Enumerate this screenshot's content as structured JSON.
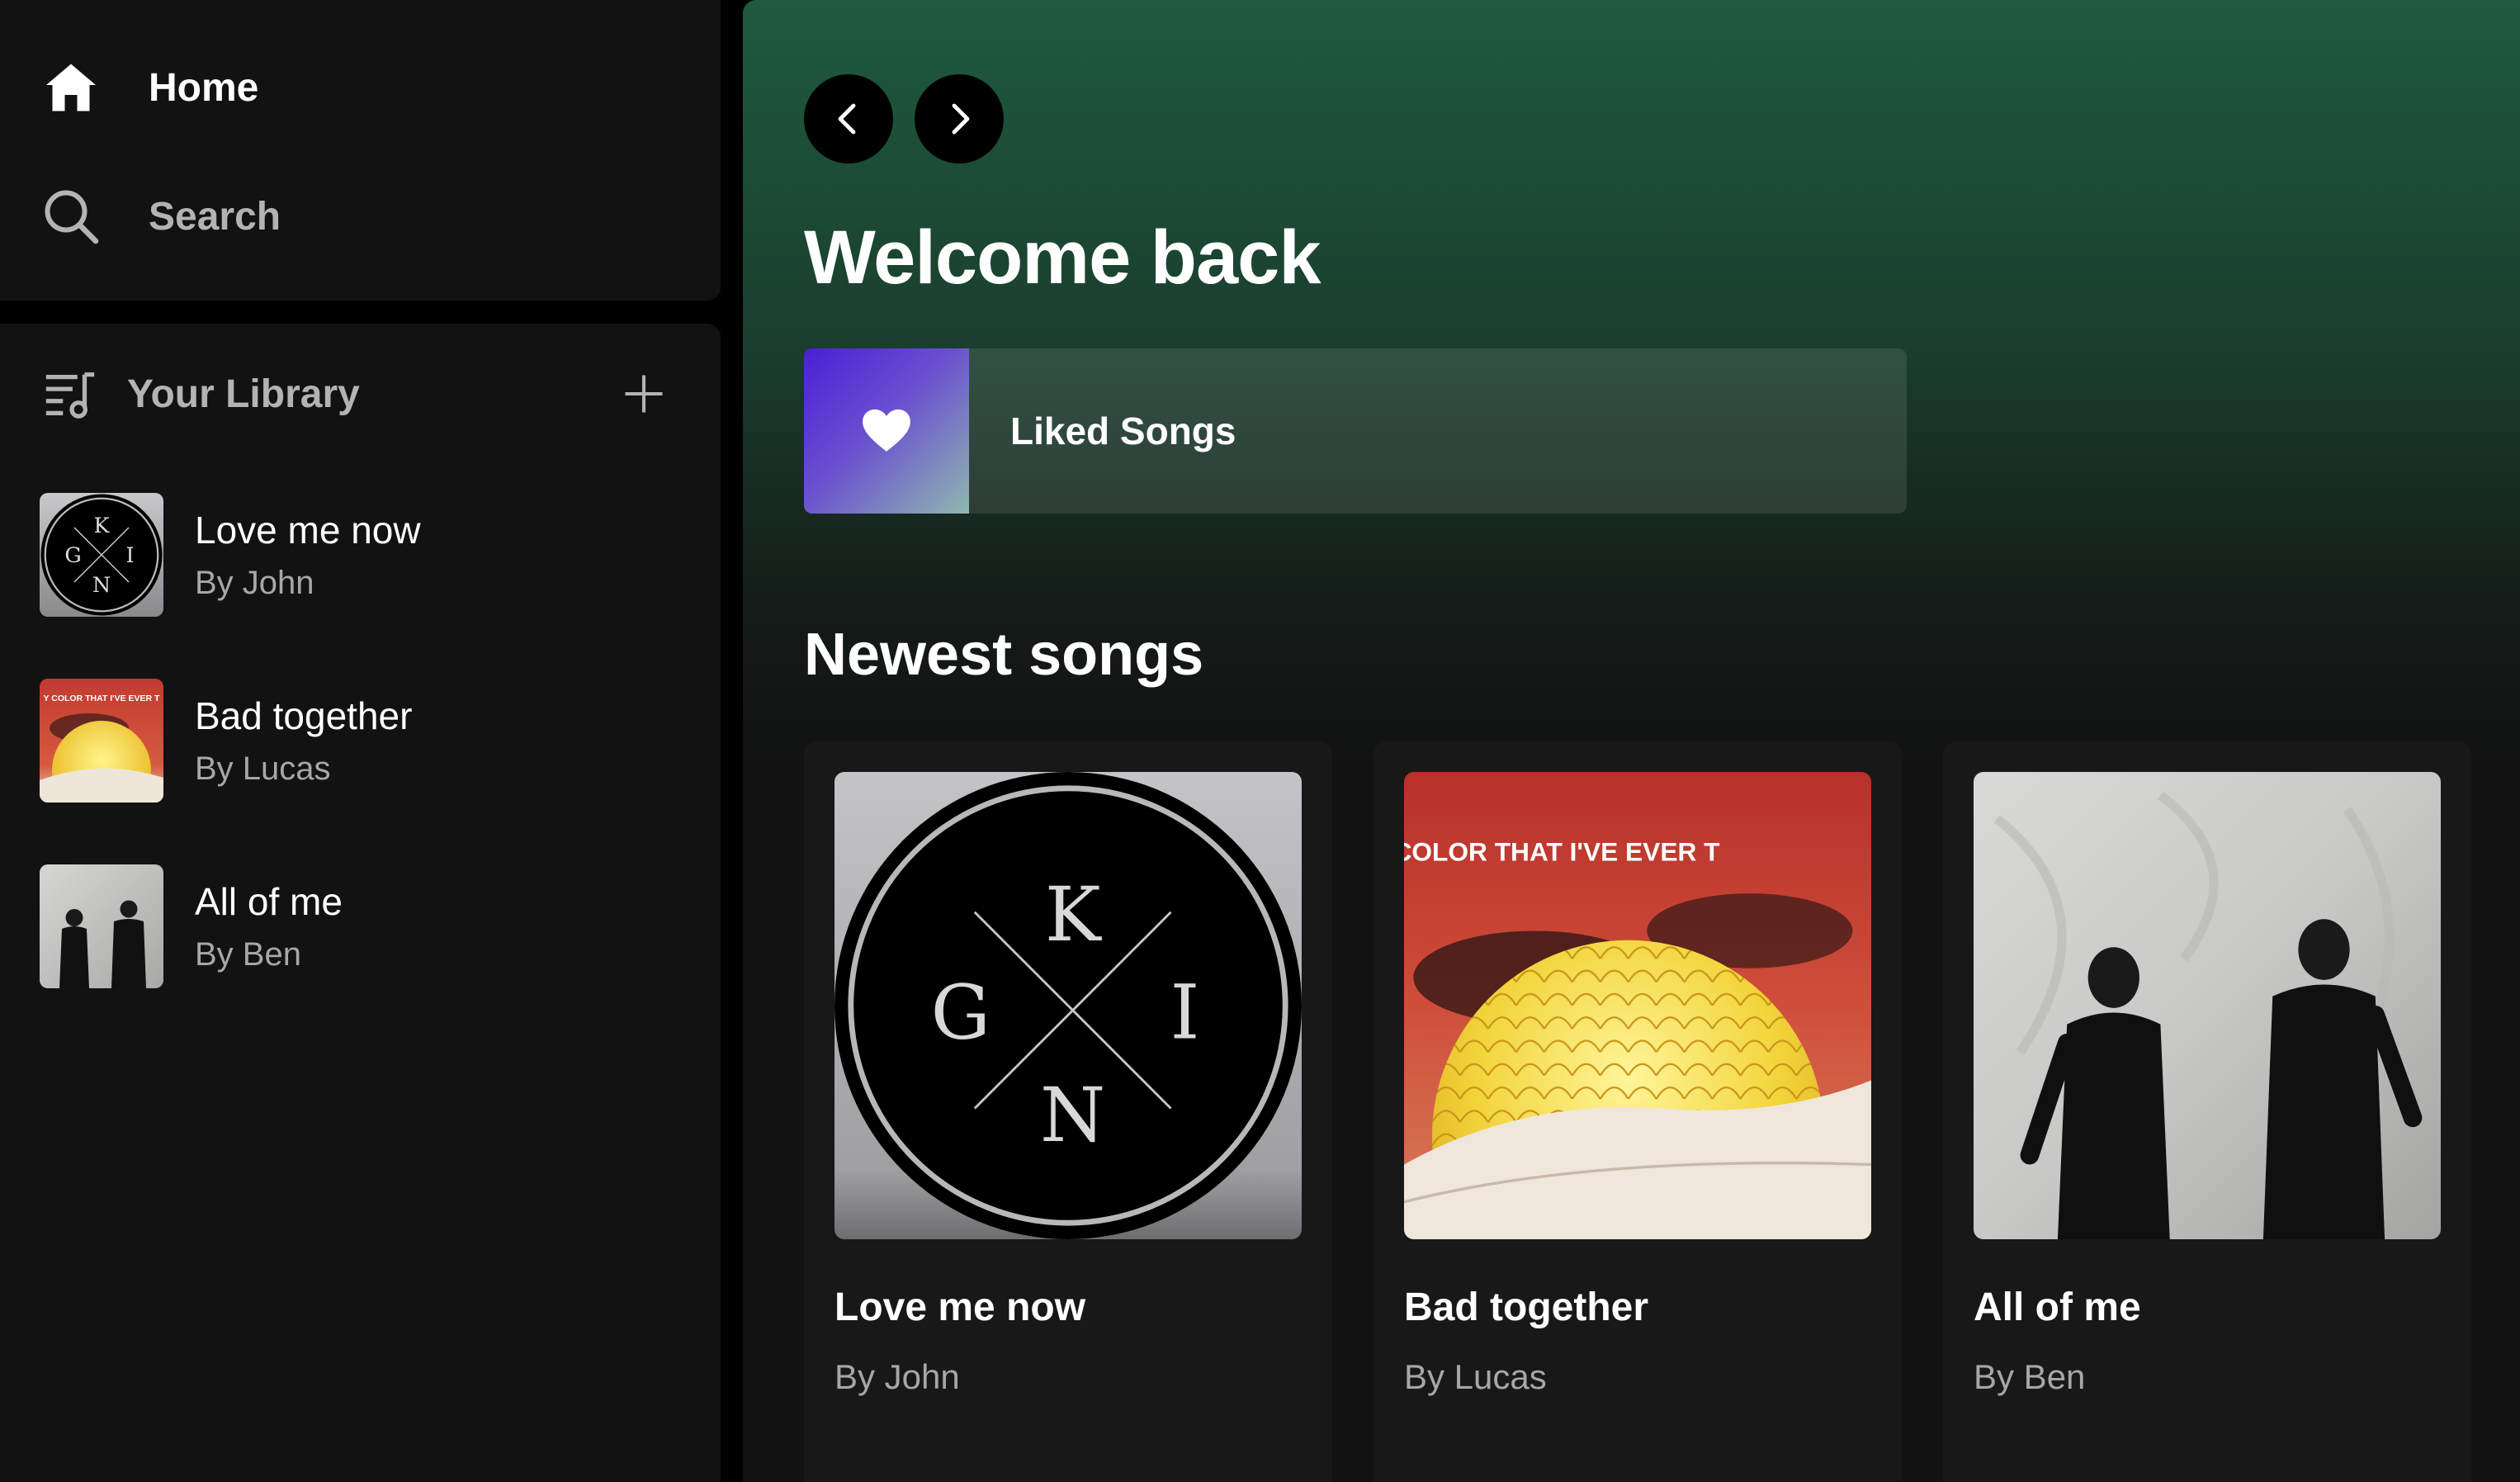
{
  "sidebar": {
    "nav": {
      "home": {
        "label": "Home",
        "icon": "home-icon"
      },
      "search": {
        "label": "Search",
        "icon": "search-icon"
      }
    },
    "library": {
      "label": "Your Library",
      "icon": "library-icon",
      "add_icon": "plus-icon",
      "items": [
        {
          "title": "Love me now",
          "subtitle": "By John",
          "art": "kgin-logo-art"
        },
        {
          "title": "Bad together",
          "subtitle": "By Lucas",
          "art": "yellow-sphere-art"
        },
        {
          "title": "All of me",
          "subtitle": "By Ben",
          "art": "two-men-art"
        }
      ]
    }
  },
  "main": {
    "back_icon": "chevron-left-icon",
    "forward_icon": "chevron-right-icon",
    "welcome": "Welcome back",
    "liked_songs": {
      "label": "Liked Songs",
      "icon": "heart-icon"
    },
    "section_title": "Newest songs",
    "songs": [
      {
        "title": "Love me now",
        "subtitle": "By John",
        "art": "kgin-logo-art",
        "art_letters": [
          "K",
          "G",
          "I",
          "N"
        ]
      },
      {
        "title": "Bad together",
        "subtitle": "By Lucas",
        "art": "yellow-sphere-art",
        "art_text": "Y COLOR THAT I'VE EVER T"
      },
      {
        "title": "All of me",
        "subtitle": "By Ben",
        "art": "two-men-art"
      }
    ]
  },
  "colors": {
    "background": "#000000",
    "panel": "#121212",
    "card": "#181818",
    "header_gradient_top": "#1e5a3f",
    "muted_text": "#a7a7a7",
    "liked_gradient_start": "#4a1fd6",
    "liked_gradient_end": "#8fb8b0"
  }
}
